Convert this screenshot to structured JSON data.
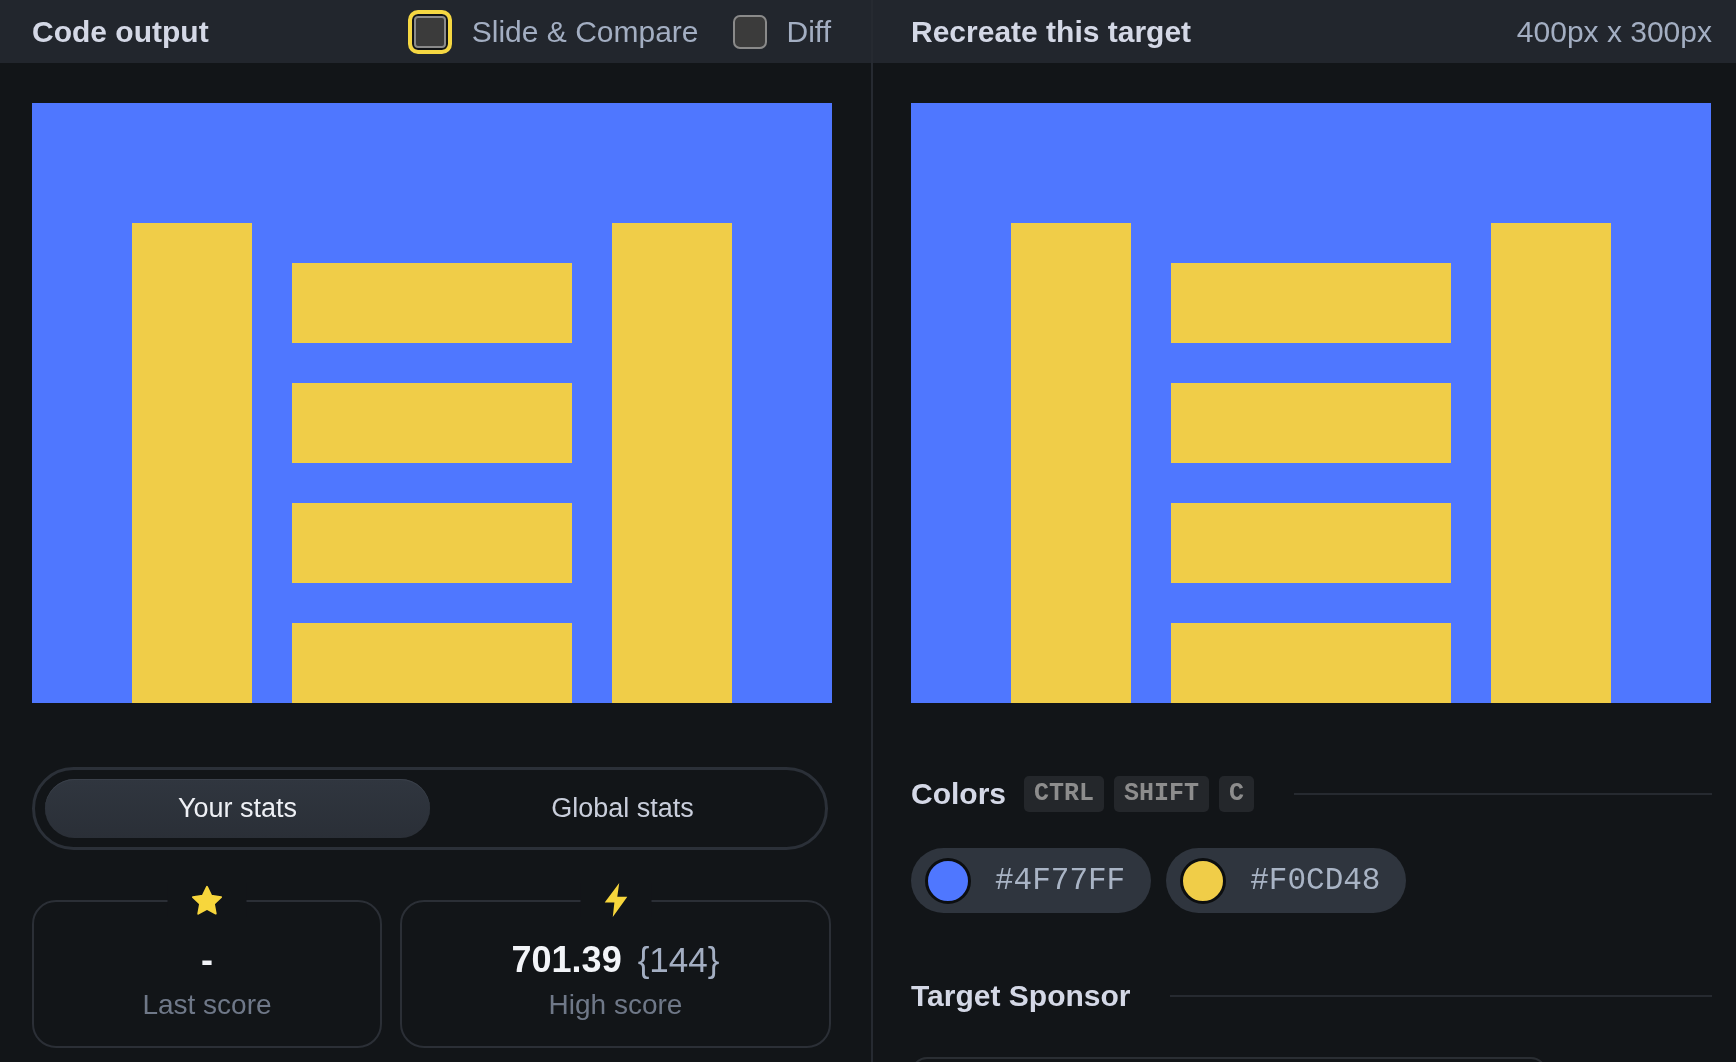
{
  "left_panel": {
    "title": "Code output",
    "options": [
      {
        "label": "Slide & Compare",
        "checked": false,
        "focused": true
      },
      {
        "label": "Diff",
        "checked": false,
        "focused": false
      }
    ],
    "stats_tabs": [
      {
        "label": "Your stats",
        "selected": true
      },
      {
        "label": "Global stats",
        "selected": false
      }
    ],
    "stats": [
      {
        "kind": "star",
        "value": "-",
        "label": "Last score"
      },
      {
        "kind": "bolt",
        "value": "701.39",
        "detail": "{144}",
        "label": "High score"
      }
    ]
  },
  "right_panel": {
    "title": "Recreate this target",
    "size": "400px x 300px",
    "colors": {
      "title": "Colors",
      "shortcut": [
        "CTRL",
        "SHIFT",
        "C"
      ],
      "swatches": [
        {
          "code": "#4F77FF",
          "color": "#4f77ff"
        },
        {
          "code": "#F0CD48",
          "color": "#f0cd48"
        }
      ]
    },
    "sponsor": {
      "title": "Target Sponsor"
    }
  }
}
